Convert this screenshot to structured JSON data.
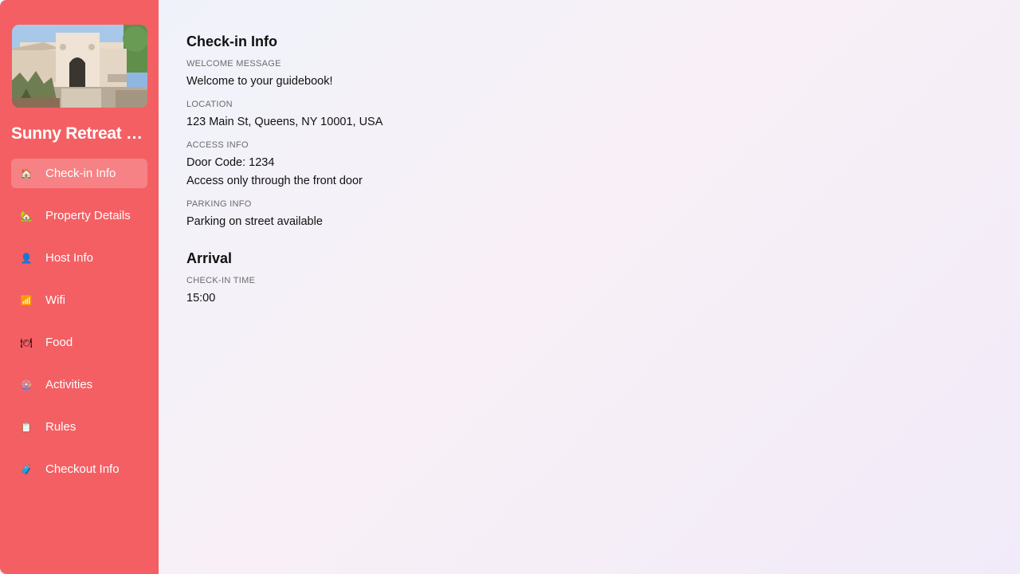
{
  "sidebar": {
    "property_name": "Sunny Retreat …",
    "accent_color": "#f45f63",
    "photo_icon": "house-photo",
    "items": [
      {
        "label": "Check-in Info",
        "icon": "house-icon",
        "glyph": "🏠",
        "active": true
      },
      {
        "label": "Property Details",
        "icon": "house-garden-icon",
        "glyph": "🏡",
        "active": false
      },
      {
        "label": "Host Info",
        "icon": "person-icon",
        "glyph": "👤",
        "active": false
      },
      {
        "label": "Wifi",
        "icon": "signal-bars-icon",
        "glyph": "📶",
        "active": false
      },
      {
        "label": "Food",
        "icon": "plate-icon",
        "glyph": "🍽",
        "active": false
      },
      {
        "label": "Activities",
        "icon": "ferris-wheel-icon",
        "glyph": "🎡",
        "active": false
      },
      {
        "label": "Rules",
        "icon": "clipboard-icon",
        "glyph": "📋",
        "active": false
      },
      {
        "label": "Checkout Info",
        "icon": "luggage-icon",
        "glyph": "🧳",
        "active": false
      }
    ]
  },
  "checkin": {
    "title": "Check-in Info",
    "welcome_label": "WELCOME MESSAGE",
    "welcome_value": "Welcome to your guidebook!",
    "location_label": "LOCATION",
    "location_value": "123 Main St, Queens, NY 10001, USA",
    "access_label": "ACCESS INFO",
    "access_line1": "Door Code: 1234",
    "access_line2": "Access only through the front door",
    "parking_label": "PARKING INFO",
    "parking_value": "Parking on street available"
  },
  "arrival": {
    "title": "Arrival",
    "checkin_time_label": "CHECK-IN TIME",
    "checkin_time_value": "15:00"
  }
}
